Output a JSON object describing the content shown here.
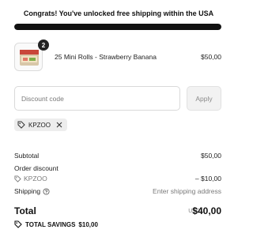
{
  "banner": {
    "message": "Congrats! You've unlocked free shipping within the USA",
    "progress_fraction": 1.0
  },
  "cart": {
    "items": [
      {
        "quantity": "2",
        "name": "25 Mini Rolls - Strawberry Banana",
        "price": "$50,00"
      }
    ]
  },
  "discount": {
    "placeholder": "Discount code",
    "apply_label": "Apply",
    "applied_code": "KPZOO"
  },
  "summary": {
    "subtotal_label": "Subtotal",
    "subtotal_value": "$50,00",
    "order_discount_label": "Order discount",
    "order_discount_code": "KPZOO",
    "order_discount_value": "– $10,00",
    "shipping_label": "Shipping",
    "shipping_value": "Enter shipping address",
    "total_label": "Total",
    "total_currency": "USD",
    "total_value": "$40,00",
    "savings_label": "TOTAL SAVINGS",
    "savings_value": "$10,00"
  },
  "icons": {
    "tag": "tag-icon",
    "close": "close-icon",
    "help": "help-circle-icon"
  },
  "colors": {
    "accent": "#111111",
    "muted": "#7a7a7a",
    "chip_bg": "#ededed"
  }
}
